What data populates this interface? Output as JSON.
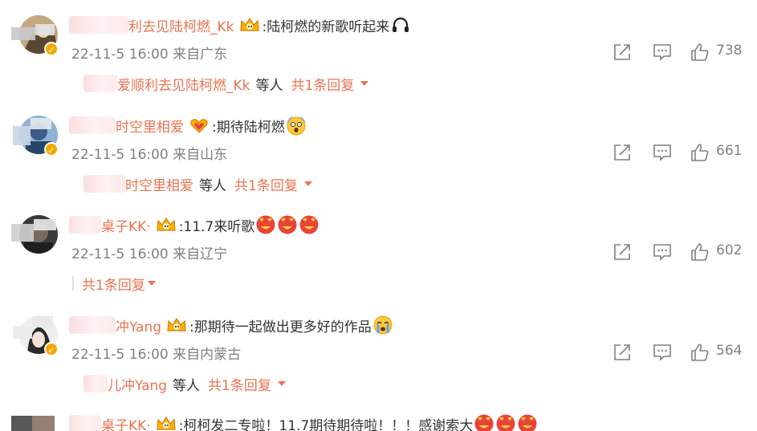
{
  "comments": [
    {
      "username_visible": "利去见陆柯燃_Kk",
      "text": ":陆柯燃的新歌听起来",
      "date": "22-11-5 16:00",
      "location": "来自广东",
      "likes": "738",
      "reply_name_visible": "爱顺利去见陆柯燃_Kk",
      "reply_etc": "等人",
      "reply_link": "共1条回复"
    },
    {
      "username_visible": "时空里相爱",
      "text": ":期待陆柯燃",
      "date": "22-11-5 16:00",
      "location": "来自山东",
      "likes": "661",
      "reply_name_visible": "时空里相爱",
      "reply_etc": "等人",
      "reply_link": "共1条回复"
    },
    {
      "username_visible": "桌子KK·",
      "text": ":11.7来听歌",
      "date": "22-11-5 16:00",
      "location": "来自辽宁",
      "likes": "602",
      "reply_link": "共1条回复"
    },
    {
      "username_visible": "冲Yang",
      "text": ":那期待一起做出更多好的作品",
      "date": "22-11-5 16:00",
      "location": "来自内蒙古",
      "likes": "564",
      "reply_name_visible": "儿冲Yang",
      "reply_etc": "等人",
      "reply_link": "共1条回复"
    },
    {
      "username_visible": "桌子KK·",
      "text": ":柯柯发二专啦！11.7期待期待啦！！！感谢索大"
    }
  ],
  "icons": {
    "share": "share-icon",
    "comment": "comment-icon",
    "like": "like-icon",
    "verified": "verified-badge-icon",
    "crown": "crown-badge-icon"
  },
  "colors": {
    "username": "#eb7350",
    "meta": "#808080",
    "text": "#333333",
    "verified": "#f7a700"
  }
}
